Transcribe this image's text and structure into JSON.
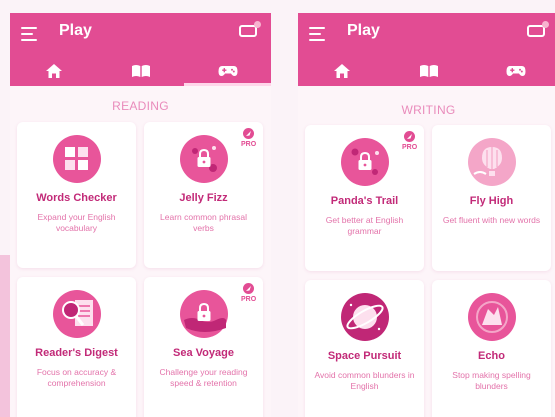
{
  "colors": {
    "brand": "#e24c93",
    "accent_text": "#c22a78",
    "desc_text": "#e373aa",
    "section": "#e98bbb",
    "background": "#fbf3f8"
  },
  "screens": [
    {
      "title": "Play",
      "tabs": [
        {
          "icon": "home-icon"
        },
        {
          "icon": "book-icon"
        },
        {
          "icon": "gamepad-icon",
          "active": true
        }
      ],
      "section": "READING",
      "games": [
        {
          "name": "Words Checker",
          "desc": "Expand your English vocabulary",
          "pro": false,
          "icon": "tiles-icon"
        },
        {
          "name": "Jelly Fizz",
          "desc": "Learn common phrasal verbs",
          "pro": true,
          "pro_label": "PRO",
          "icon": "jelly-lock-icon"
        },
        {
          "name": "Reader's Digest",
          "desc": "Focus on accuracy & comprehension",
          "pro": false,
          "icon": "magnifier-icon"
        },
        {
          "name": "Sea Voyage",
          "desc": "Challenge your reading speed & retention",
          "pro": true,
          "pro_label": "PRO",
          "icon": "sea-lock-icon"
        }
      ]
    },
    {
      "title": "Play",
      "tabs": [
        {
          "icon": "home-icon"
        },
        {
          "icon": "book-icon"
        },
        {
          "icon": "gamepad-icon",
          "active": true
        }
      ],
      "section": "WRITING",
      "games": [
        {
          "name": "Panda's Trail",
          "desc": "Get better at English grammar",
          "pro": true,
          "pro_label": "PRO",
          "icon": "panda-lock-icon"
        },
        {
          "name": "Fly High",
          "desc": "Get fluent with new words",
          "pro": false,
          "icon": "balloon-icon"
        },
        {
          "name": "Space Pursuit",
          "desc": "Avoid common blunders in English",
          "pro": false,
          "icon": "planet-icon"
        },
        {
          "name": "Echo",
          "desc": "Stop making spelling blunders",
          "pro": false,
          "icon": "echo-icon"
        }
      ]
    }
  ]
}
